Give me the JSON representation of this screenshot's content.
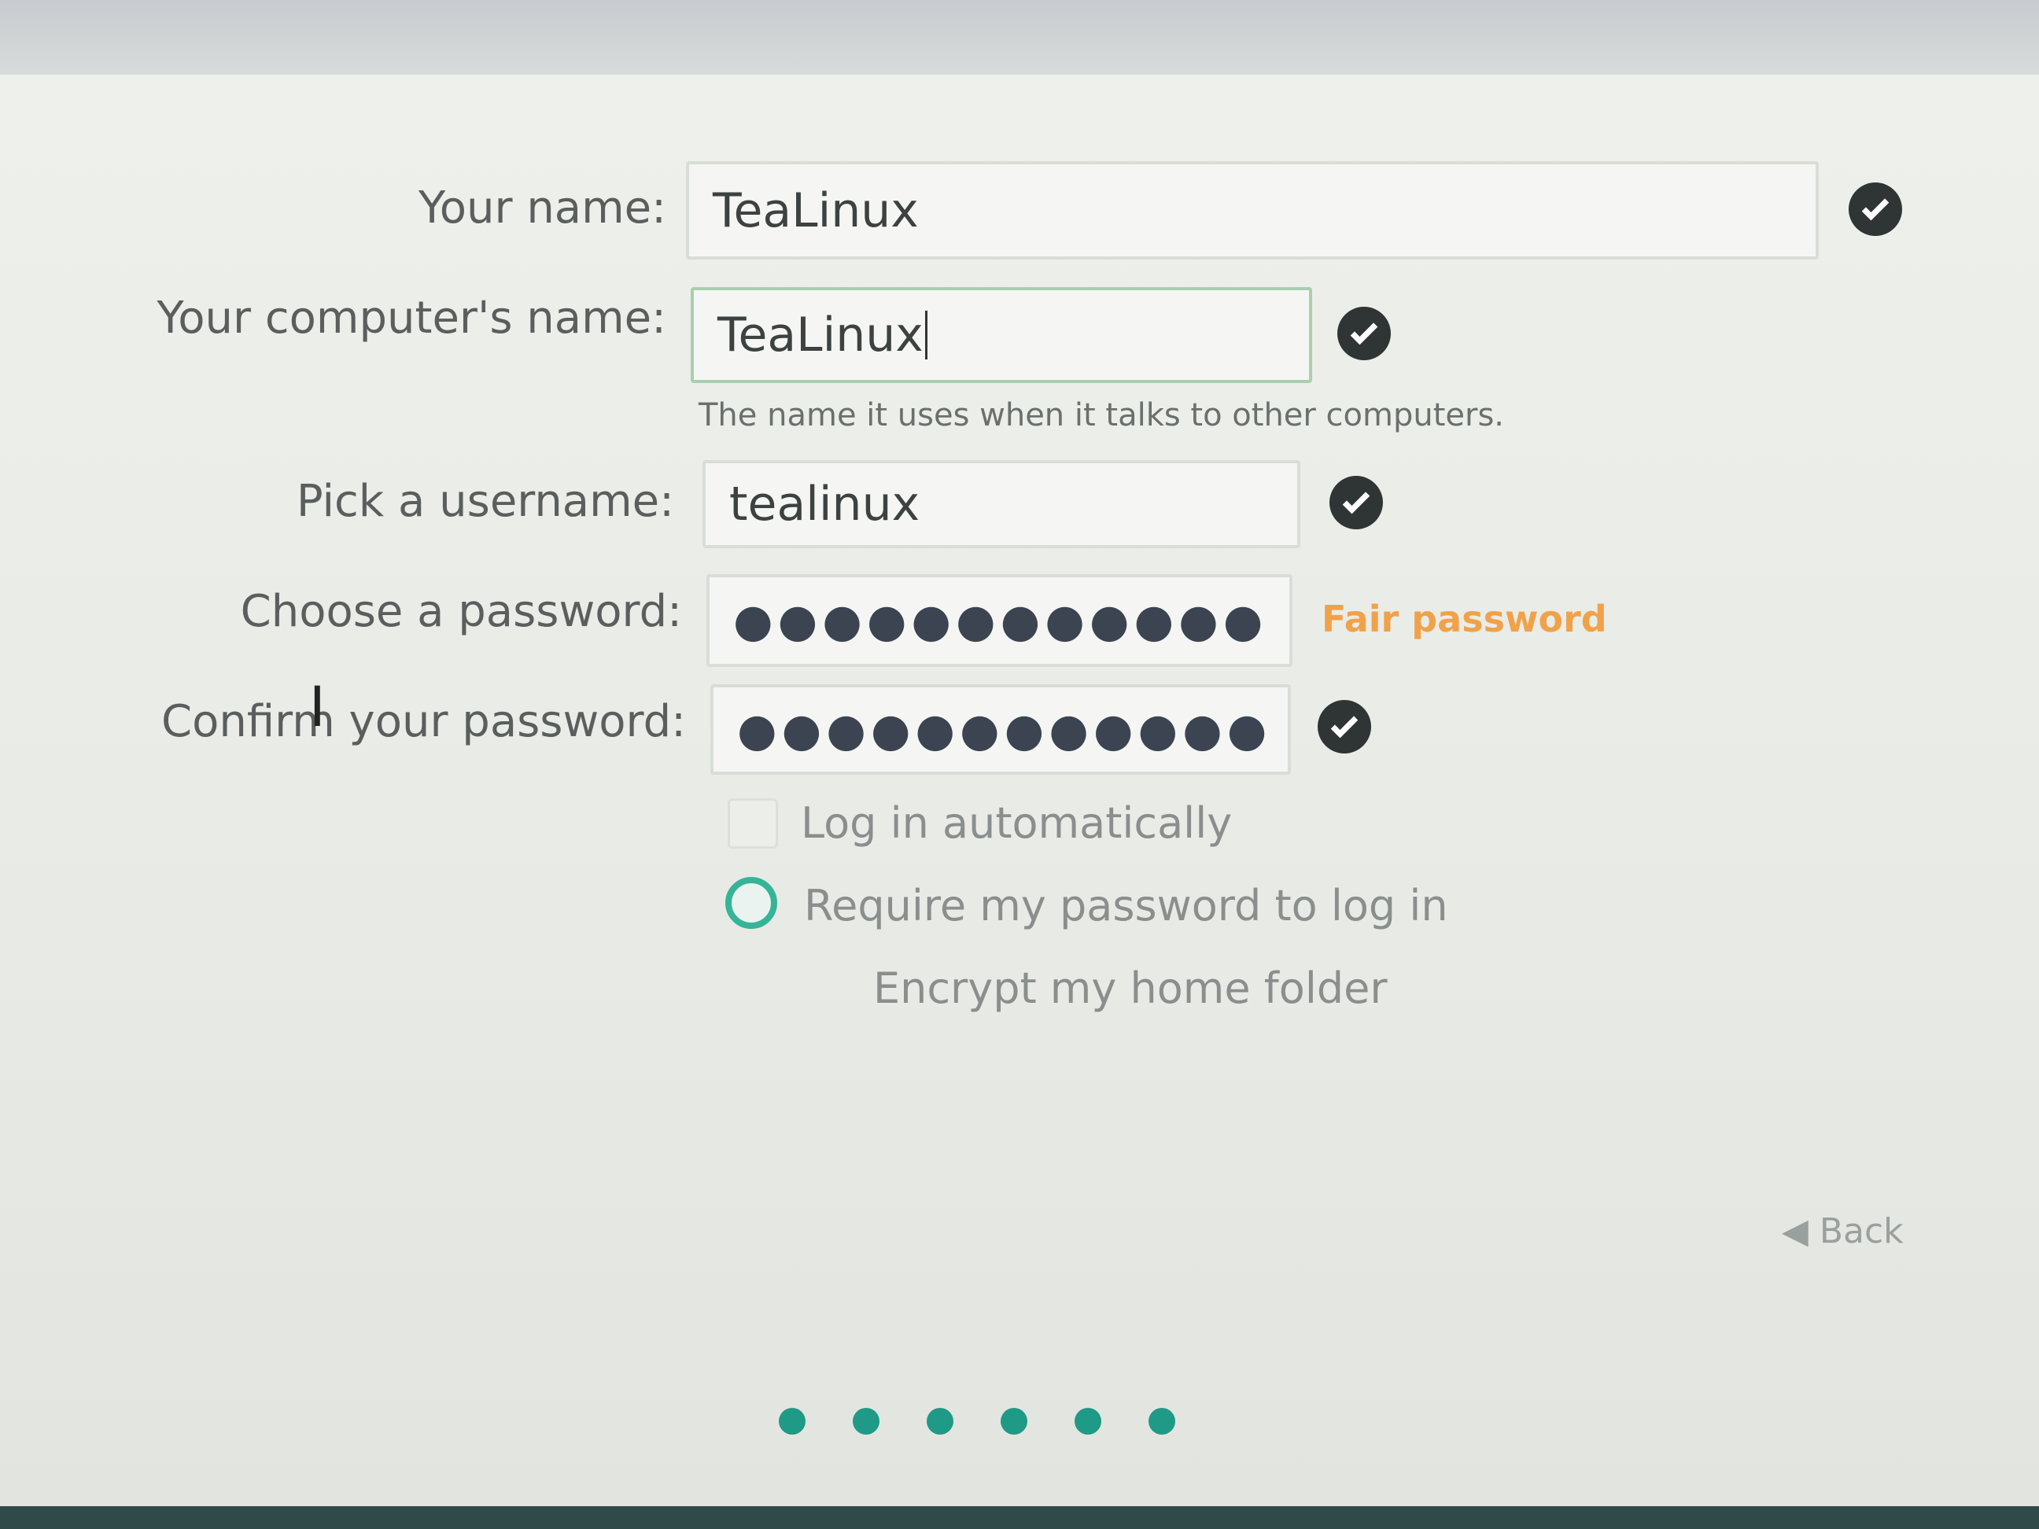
{
  "form": {
    "your_name": {
      "label": "Your name:",
      "value": "TeaLinux"
    },
    "computer_name": {
      "label": "Your computer's name:",
      "value": "TeaLinux",
      "hint": "The name it uses when it talks to other computers."
    },
    "username": {
      "label": "Pick a username:",
      "value": "tealinux"
    },
    "password": {
      "label": "Choose a password:",
      "value": "●●●●●●●●●●●●",
      "strength": "Fair password"
    },
    "confirm_password": {
      "label": "Confirm your password:",
      "value": "●●●●●●●●●●●●"
    }
  },
  "options": {
    "auto_login": "Log in automatically",
    "require_password": "Require my password to log in",
    "encrypt_home": "Encrypt my home folder"
  },
  "nav": {
    "back": "Back",
    "cursor_glyph": "I"
  },
  "pager": {
    "total_steps": 6
  },
  "colors": {
    "accent": "#36b497",
    "strength_fair": "#f0a24a",
    "check_bg": "#2f3435"
  }
}
